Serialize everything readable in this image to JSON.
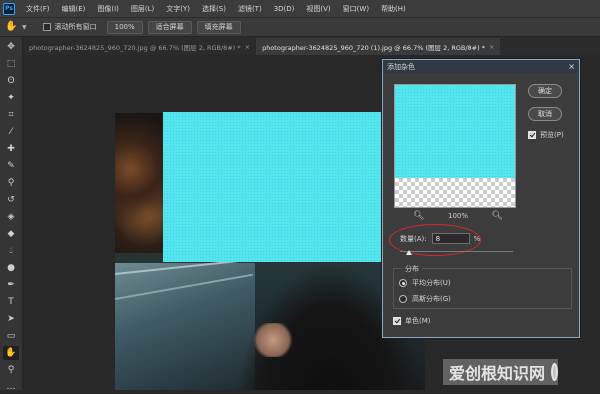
{
  "app": {
    "logo_text": "Ps"
  },
  "menubar": {
    "items": [
      "文件(F)",
      "编辑(E)",
      "图像(I)",
      "图层(L)",
      "文字(Y)",
      "选择(S)",
      "滤镜(T)",
      "3D(D)",
      "视图(V)",
      "窗口(W)",
      "帮助(H)"
    ]
  },
  "options": {
    "scroll_all_windows": "滚动所有窗口",
    "zoom_value": "100%",
    "fit_screen": "适合屏幕",
    "fill_screen": "填充屏幕"
  },
  "tabs": [
    {
      "label": "photographer-3624825_960_720.jpg @ 66.7% (图层 2, RGB/8#) *",
      "close": "×",
      "active": false
    },
    {
      "label": "photographer-3624825_960_720 (1).jpg @ 66.7% (图层 2, RGB/8#) *",
      "close": "×",
      "active": true
    }
  ],
  "dialog": {
    "title": "添加杂色",
    "close": "×",
    "ok": "确定",
    "cancel": "取消",
    "preview_label": "预览(P)",
    "preview_checked": true,
    "zoom_out": "🔍︎",
    "zoom_percent": "100%",
    "zoom_in": "🔍︎",
    "amount_label": "数量(A):",
    "amount_value": "8",
    "amount_unit": "%",
    "amount_fraction": 0.08,
    "distribution_title": "分布",
    "uniform": "平均分布(U)",
    "gaussian": "高斯分布(G)",
    "uniform_selected": true,
    "monochrome": "单色(M)",
    "monochrome_checked": true
  },
  "colors": {
    "noise_fill": "#55e5ef",
    "highlight_ring": "#d42b2b",
    "dialog_border": "#8aa9c7"
  },
  "watermark": {
    "text": "爱创根知识网"
  }
}
